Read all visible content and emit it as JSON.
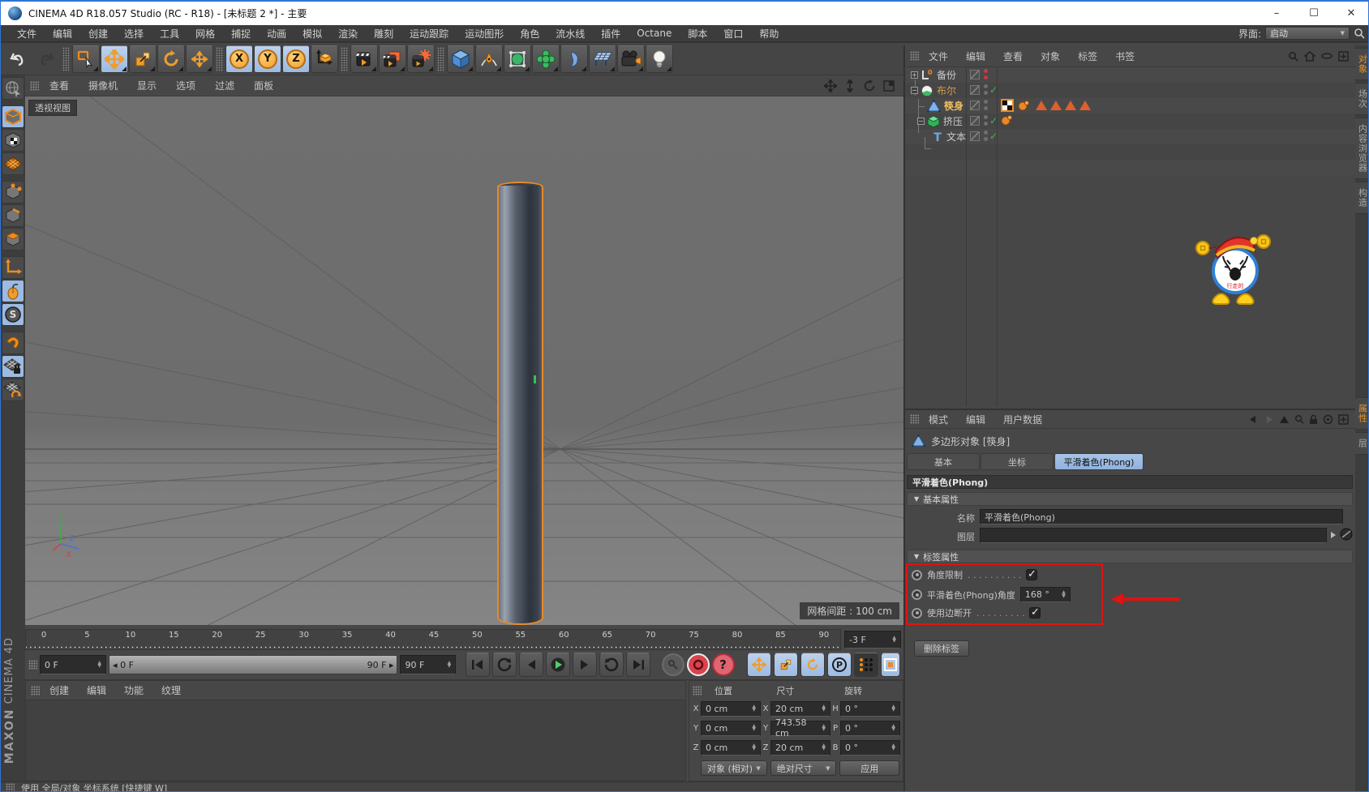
{
  "window": {
    "title": "CINEMA 4D R18.057 Studio (RC - R18) - [未标题 2 *] - 主要",
    "minimize": "–",
    "maximize": "☐",
    "close": "✕"
  },
  "menubar": {
    "items": [
      "文件",
      "编辑",
      "创建",
      "选择",
      "工具",
      "网格",
      "捕捉",
      "动画",
      "模拟",
      "渲染",
      "雕刻",
      "运动跟踪",
      "运动图形",
      "角色",
      "流水线",
      "插件",
      "Octane",
      "脚本",
      "窗口",
      "帮助"
    ],
    "interface_label": "界面:",
    "interface_value": "启动"
  },
  "viewport": {
    "menu": [
      "查看",
      "摄像机",
      "显示",
      "选项",
      "过滤",
      "面板"
    ],
    "view_label": "透视视图",
    "grid_spacing": "网格间距 : 100 cm",
    "axis": {
      "x": "X",
      "y": "Y",
      "z": "Z"
    }
  },
  "object_manager": {
    "menu": [
      "文件",
      "编辑",
      "查看",
      "对象",
      "标签",
      "书签"
    ],
    "objects": [
      {
        "name": "备份"
      },
      {
        "name": "布尔"
      },
      {
        "name": "筷身"
      },
      {
        "name": "挤压"
      },
      {
        "name": "文本"
      }
    ]
  },
  "side_tabs": {
    "top": [
      "对象",
      "场次",
      "内容浏览器",
      "构造"
    ],
    "bottom": [
      "属性",
      "层"
    ]
  },
  "attributes": {
    "menu": [
      "模式",
      "编辑",
      "用户数据"
    ],
    "object_title": "多边形对象 [筷身]",
    "tabs": [
      "基本",
      "坐标",
      "平滑着色(Phong)"
    ],
    "section_title": "平滑着色(Phong)",
    "group_basic": "基本属性",
    "name_label": "名称",
    "name_value": "平滑着色(Phong)",
    "layer_label": "图层",
    "group_tag": "标签属性",
    "angle_limit_label": "角度限制",
    "angle_limit_dots": ". . . . . . . . . .",
    "phong_angle_label": "平滑着色(Phong)角度",
    "phong_angle_value": "168 °",
    "edge_break_label": "使用边断开",
    "edge_break_dots": ". . . . . . . . .",
    "delete_tag_button": "删除标签"
  },
  "timeline": {
    "ticks": [
      "0",
      "5",
      "10",
      "15",
      "20",
      "25",
      "30",
      "35",
      "40",
      "45",
      "50",
      "55",
      "60",
      "65",
      "70",
      "75",
      "80",
      "85",
      "90"
    ],
    "offset_value": "-3 F",
    "current_value": "0 F",
    "slider_left": "0 F",
    "slider_right": "90 F",
    "end_value": "90 F"
  },
  "materials": {
    "menu": [
      "创建",
      "编辑",
      "功能",
      "纹理"
    ]
  },
  "coordinates": {
    "headers": [
      "位置",
      "尺寸",
      "旋转"
    ],
    "rows": [
      {
        "pl": "X",
        "pv": "0 cm",
        "sl": "X",
        "sv": "20 cm",
        "rl": "H",
        "rv": "0 °"
      },
      {
        "pl": "Y",
        "pv": "0 cm",
        "sl": "Y",
        "sv": "743.58 cm",
        "rl": "P",
        "rv": "0 °"
      },
      {
        "pl": "Z",
        "pv": "0 cm",
        "sl": "Z",
        "sv": "20 cm",
        "rl": "B",
        "rv": "0 °"
      }
    ],
    "mode_object": "对象 (相对)",
    "mode_size": "绝对尺寸",
    "apply": "应用"
  },
  "statusbar": {
    "text": "使用 全局/对象 坐标系统 [快捷键 W]"
  },
  "branding": {
    "logo_bold": "MAXON",
    "logo_text": "CINEMA 4D"
  },
  "mascot": {
    "text": "行走的"
  },
  "colors": {
    "accent_orange": "#e8882a",
    "selection_blue": "#9cbae2",
    "annotation_red": "#e01212",
    "check_green": "#46b64e",
    "play_green": "#4ed06e"
  }
}
